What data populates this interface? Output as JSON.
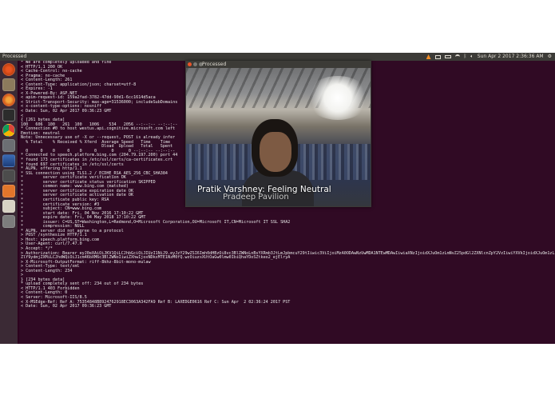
{
  "topbar": {
    "title": "Processed",
    "clock": "Sun Apr 2 2017  2:36:36 AM"
  },
  "launcher": {
    "icons": [
      "ubuntu-dash-icon",
      "files-icon",
      "firefox-icon",
      "terminal-icon",
      "chrome-icon",
      "settings-icon",
      "app-icon",
      "camera-icon",
      "software-icon",
      "text-editor-icon",
      "trash-icon"
    ]
  },
  "window": {
    "title": "Processed",
    "caption_line1": "Pratik Varshney: Feeling Neutral",
    "caption_line2": "Pradeep Pavilion"
  },
  "terminal": {
    "lines": [
      "* We are completely uploaded and fine",
      "< HTTP/1.1 200 OK",
      "< Cache-Control: no-cache",
      "< Pragma: no-cache",
      "< Content-Length: 261",
      "< Content-Type: application/json; charset=utf-8",
      "< Expires: -1",
      "< X-Powered-By: ASP.NET",
      "< apim-request-id: 159a2fad-3782-47dd-90d1-6cc1614d5aca",
      "< Strict-Transport-Security: max-age=31536000; includeSubDomains",
      "< x-content-type-options: nosniff",
      "< Date: Sun, 02 Apr 2017 09:36:23 GMT",
      "<",
      "{ [261 bytes data]",
      "100   606  100   261  100   1006    534   2056 --:--:-- --:--:--",
      "* Connection #0 to host westus.api.cognitive.microsoft.com left",
      "Emotion: neutral",
      "Note: Unnecessary use of -X or --request, POST is already infer",
      "  % Total    % Received % Xferd  Average Speed   Time    Time",
      "                                 Dload  Upload   Total   Spent",
      "  0     0    0     0    0     0      0      0 --:--:-- --:--:--",
      "* Connected to speech.platform.bing.com (204.79.197.200) port 44",
      "* found 173 certificates in /etc/ssl/certs/ca-certificates.crt",
      "* found 697 certificates in /etc/ssl/certs",
      "* ALPN, offering http/1.1",
      "* SSL connection using TLS1.2 / ECDHE_RSA_AES_256_CBC_SHA384",
      "*        server certificate verification OK",
      "*        server certificate status verification SKIPPED",
      "*        common name: www.bing.com (matched)",
      "*        server certificate expiration date OK",
      "*        server certificate activation date OK",
      "*        certificate public key: RSA",
      "*        certificate version: #3",
      "*        subject: CN=www.bing.com",
      "*        start date: Fri, 04 Nov 2016 17:10:22 GMT",
      "*        expire date: Fri, 04 May 2018 17:10:22 GMT",
      "*        issuer: C=US,ST=Washington,L=Redmond,O=Microsoft Corporation,OU=Microsoft IT,CN=Microsoft IT SSL SHA2",
      "*        compression: NULL",
      "* ALPN, server did not agree to a protocol",
      "> POST /synthesize HTTP/1.1",
      "> Host: speech.platform.bing.com",
      "> User-Agent: curl/7.47.0",
      "> Accept: */*",
      "> Authorization: Bearer eyJ0eXAiOiJKV1QiLCJhbGciOiJIUzI1NiJ9.eyJzY29wZSI6Imh0dHBzOi8vc3BlZWNoLnBsYXRmb3JtLmJpbmcuY29tIiwic3ViIjoiMzA0ODAwNzUwMDA1NTEwMDAwIiwiaXNzIjoidXJuOm1zLmNvZ25pdGl2ZXNlcnZpY2VzIiwiYXVkIjoidXJuOm1zLnNwZWVjaCIsImV4cCI6MTQ5MTEyNjM4M",
      "ZlY9ydmjZXMiLCJhdWQiOiJ1cm46bXM6c3BlZWNoIiwiZXhwIjoxNDkxMTE1NzM0fQ.wzOiuzsXUtOaGw0lmw0IbiQhaYDoSZtkeo2_ejElryA",
      "> X-Microsoft-OutputFormat: riff-8khz-8bit-mono-mulaw",
      "> Content-Type: text/xml",
      "> Content-Length: 234",
      ">",
      "} [234 bytes data]",
      "* upload completely sent off: 234 out of 234 bytes",
      "< HTTP/1.1 403 Forbidden",
      "< Content-Length: 0",
      "< Server: Microsoft-IIS/8.5",
      "< X-MSEdge-Ref: Ref A: 75354848B8924762918EC3063A342FA9 Ref B: LAXEDGE0616 Ref C: Sun Apr  2 02:36:24 2017 PST",
      "< Date: Sun, 02 Apr 2017 09:36:23 GMT"
    ]
  },
  "colors": {
    "terminal_bg": "#300a24",
    "panel_bg": "#3c3b37",
    "launcher_bg": "#3b2a35"
  }
}
